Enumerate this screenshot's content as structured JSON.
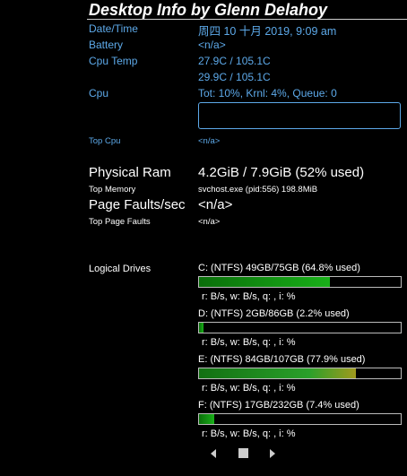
{
  "title": "Desktop Info by Glenn Delahoy",
  "datetime": {
    "label": "Date/Time",
    "value": "周四 10 十月 2019, 9:09 am"
  },
  "battery": {
    "label": "Battery",
    "value": "<n/a>"
  },
  "cpu_temp": {
    "label": "Cpu Temp",
    "values": [
      "27.9C / 105.1C",
      "29.9C / 105.1C"
    ]
  },
  "cpu": {
    "label": "Cpu",
    "value": "Tot: 10%, Krnl:  4%, Queue: 0"
  },
  "top_cpu": {
    "label": "Top Cpu",
    "value": "<n/a>"
  },
  "physical_ram": {
    "label": "Physical Ram",
    "value": "4.2GiB / 7.9GiB (52% used)"
  },
  "top_memory": {
    "label": "Top Memory",
    "value": "svchost.exe (pid:556) 198.8MiB"
  },
  "page_faults": {
    "label": "Page Faults/sec",
    "value": "<n/a>"
  },
  "top_page_faults": {
    "label": "Top Page Faults",
    "value": "<n/a>"
  },
  "logical_drives": {
    "label": "Logical Drives",
    "drives": [
      {
        "header": "C: (NTFS) 49GB/75GB (64.8% used)",
        "used_pct": 64.8,
        "io": "r: B/s, w: B/s, q: , i: %"
      },
      {
        "header": "D: (NTFS) 2GB/86GB (2.2% used)",
        "used_pct": 2.2,
        "io": "r: B/s, w: B/s, q: , i: %"
      },
      {
        "header": "E: (NTFS) 84GB/107GB (77.9% used)",
        "used_pct": 77.9,
        "io": "r: B/s, w: B/s, q: , i: %"
      },
      {
        "header": "F: (NTFS) 17GB/232GB (7.4% used)",
        "used_pct": 7.4,
        "io": "r: B/s, w: B/s, q: , i: %"
      }
    ]
  },
  "nav": {
    "prev_icon": "left-arrow-icon",
    "stop_icon": "stop-icon",
    "next_icon": "right-arrow-icon"
  }
}
